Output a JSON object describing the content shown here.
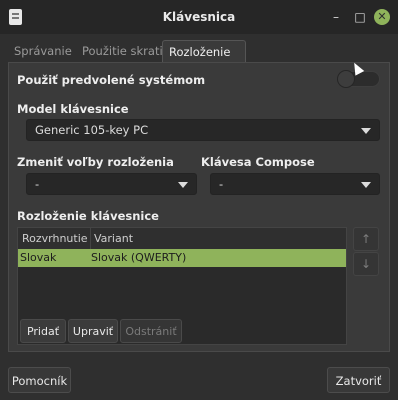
{
  "window": {
    "title": "Klávesnica",
    "buttons": {
      "minimize": "–",
      "maximize": "□",
      "close": "✕"
    }
  },
  "tabs": [
    {
      "label": "Správanie",
      "active": false
    },
    {
      "label": "Použitie skratiek",
      "active": false
    },
    {
      "label": "Rozloženie",
      "active": true
    }
  ],
  "layout_page": {
    "use_system_defaults_label": "Použiť predvolené systémom",
    "use_system_defaults_on": false,
    "model_label": "Model klávesnice",
    "model_value": "Generic 105-key PC",
    "change_options_label": "Zmeniť voľby rozloženia",
    "change_options_value": "-",
    "compose_label": "Klávesa Compose",
    "compose_value": "-",
    "layouts_label": "Rozloženie klávesnice",
    "table": {
      "columns": [
        "Rozvrhnutie",
        "Variant"
      ],
      "rows": [
        {
          "layout": "Slovak",
          "variant": "Slovak (QWERTY)",
          "selected": true
        }
      ]
    },
    "buttons": {
      "add": "Pridať",
      "edit": "Upraviť",
      "remove": "Odstrániť"
    },
    "move_up": "↑",
    "move_down": "↓"
  },
  "footer": {
    "help": "Pomocník",
    "close": "Zatvoriť"
  },
  "colors": {
    "accent": "#8fb35b",
    "background": "#2f2f2f"
  }
}
